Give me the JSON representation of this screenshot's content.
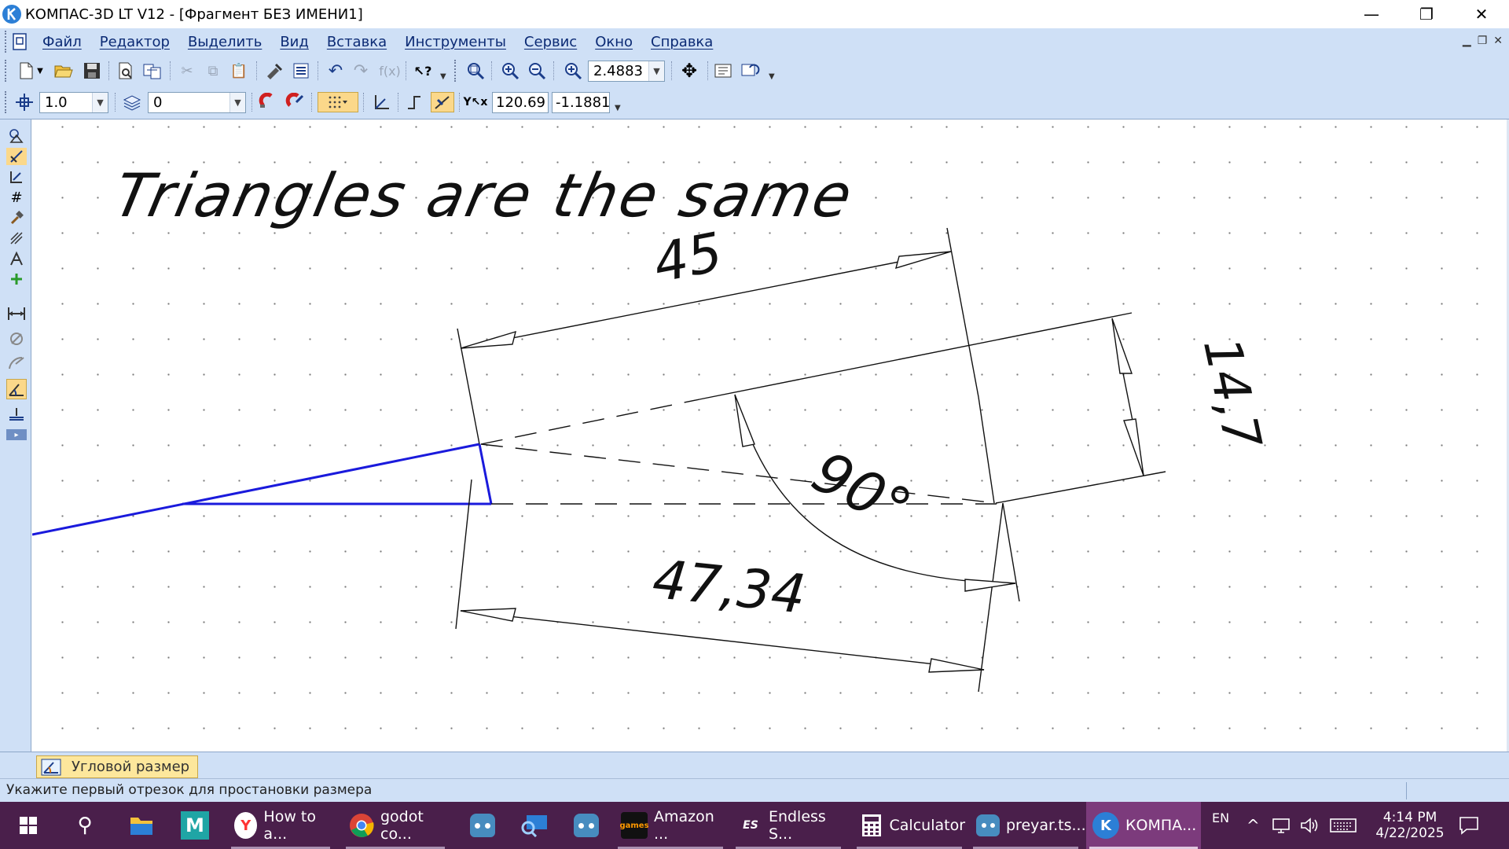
{
  "window": {
    "title": "КОМПАС-3D LT V12 - [Фрагмент БЕЗ ИМЕНИ1]",
    "minimize_glyph": "—",
    "maximize_glyph": "❐",
    "close_glyph": "✕"
  },
  "menu": {
    "items": [
      "Файл",
      "Редактор",
      "Выделить",
      "Вид",
      "Вставка",
      "Инструменты",
      "Сервис",
      "Окно",
      "Справка"
    ]
  },
  "toolbar1": {
    "zoom_value": "2.4883"
  },
  "toolbar2": {
    "step_value": "1.0",
    "layer_value": "0",
    "coord_x": "120.69",
    "coord_y": "-1.1881"
  },
  "drawing": {
    "title_text": "Triangles are the same",
    "dim_top": "45",
    "dim_right": "14,7",
    "dim_angle": "90°",
    "dim_bottom": "47,34",
    "colors": {
      "construction": "#1a1adc",
      "dimension": "#111111"
    }
  },
  "tabbar": {
    "active_tab_label": "Угловой размер"
  },
  "status": {
    "hint": "Укажите первый отрезок для простановки размера"
  },
  "taskbar": {
    "apps": [
      {
        "label": "How to a...",
        "icon": "yandex-browser-icon"
      },
      {
        "label": "godot co...",
        "icon": "chrome-icon"
      },
      {
        "label": "Amazon ...",
        "icon": "amazon-games-icon"
      },
      {
        "label": "Endless S...",
        "icon": "endless-sky-icon"
      },
      {
        "label": "Calculator",
        "icon": "calculator-icon"
      },
      {
        "label": "preyar.ts...",
        "icon": "godot-icon"
      },
      {
        "label": "КОМПА...",
        "icon": "kompas-icon"
      }
    ],
    "language": "EN",
    "time": "4:14 PM",
    "date": "4/22/2025"
  }
}
